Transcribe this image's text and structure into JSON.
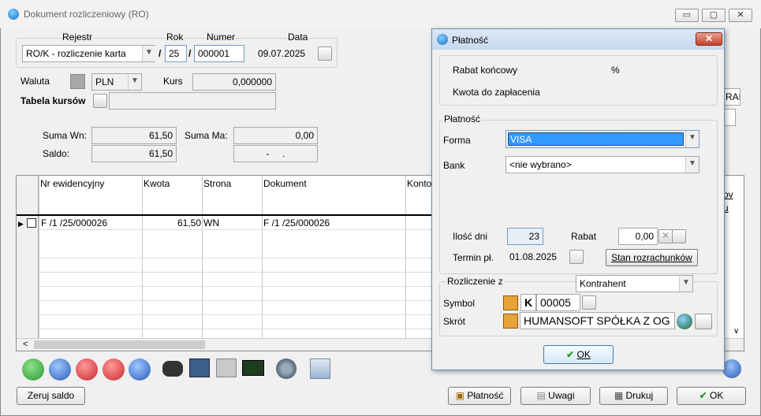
{
  "window": {
    "title": "Dokument rozliczeniowy (RO)",
    "min": "▭",
    "max": "▢",
    "close": "✕"
  },
  "header": {
    "rejestr_label": "Rejestr",
    "rok_label": "Rok",
    "numer_label": "Numer",
    "data_label": "Data",
    "rejestr_value": "RO/K  - rozliczenie karta",
    "sep1": "/",
    "rok_value": "25",
    "sep2": "/",
    "numer_value": "000001",
    "data_value": "09.07.2025"
  },
  "currency": {
    "waluta_label": "Waluta",
    "waluta_value": "PLN",
    "kurs_label": "Kurs",
    "kurs_value": "0,000000",
    "tabela_label": "Tabela kursów",
    "tabela_value": ""
  },
  "sums": {
    "suma_wn_label": "Suma Wn:",
    "suma_wn_value": "61,50",
    "suma_ma_label": "Suma Ma:",
    "suma_ma_value": "0,00",
    "saldo_label": "Saldo:",
    "saldo_value": "61,50",
    "saldo_right": "-     ."
  },
  "table": {
    "headers": [
      "Nr ewidencyjny",
      "Kwota",
      "Strona",
      "Dokument",
      "Konto"
    ],
    "rows": [
      {
        "nr": "F /1  /25/000026",
        "kwota": "61,50",
        "strona": "WN",
        "dokument": "F /1  /25/000026"
      }
    ],
    "right_partial": [
      "ov",
      "u"
    ],
    "scroll_left": "<",
    "scroll_down": "∨"
  },
  "behind_fields": {
    "ran_text": "RAN"
  },
  "bottom_buttons": {
    "zeruj": "Zeruj saldo",
    "platnosc": "Płatność",
    "uwagi": "Uwagi",
    "drukuj": "Drukuj",
    "ok": "OK"
  },
  "dialog": {
    "title": "Płatność",
    "close": "✕",
    "rabat_koncowy_label": "Rabat końcowy",
    "rabat_koncowy_unit": "%",
    "kwota_label": "Kwota do zapłacenia",
    "platnosc_group": "Płatność",
    "forma_label": "Forma",
    "forma_value": "VISA",
    "bank_label": "Bank",
    "bank_value": "<nie wybrano>",
    "ilosc_dni_label": "Ilość dni",
    "ilosc_dni_value": "23",
    "rabat_label": "Rabat",
    "rabat_value": "0,00",
    "termin_label": "Termin pł.",
    "termin_value": "01.08.2025",
    "stan_button": "Stan rozrachunków",
    "rozliczenie_label": "Rozliczenie z",
    "rozliczenie_value": "Kontrahent",
    "symbol_label": "Symbol",
    "symbol_k": "K",
    "symbol_value": "00005",
    "skrot_label": "Skrót",
    "skrot_value": "HUMANSOFT SPÓŁKA Z OG",
    "ok_button": "OK"
  },
  "colors": {
    "accent": "#3399ff",
    "ok_check": "#2e9e2e",
    "dialog_border": "#6f8fb5"
  }
}
